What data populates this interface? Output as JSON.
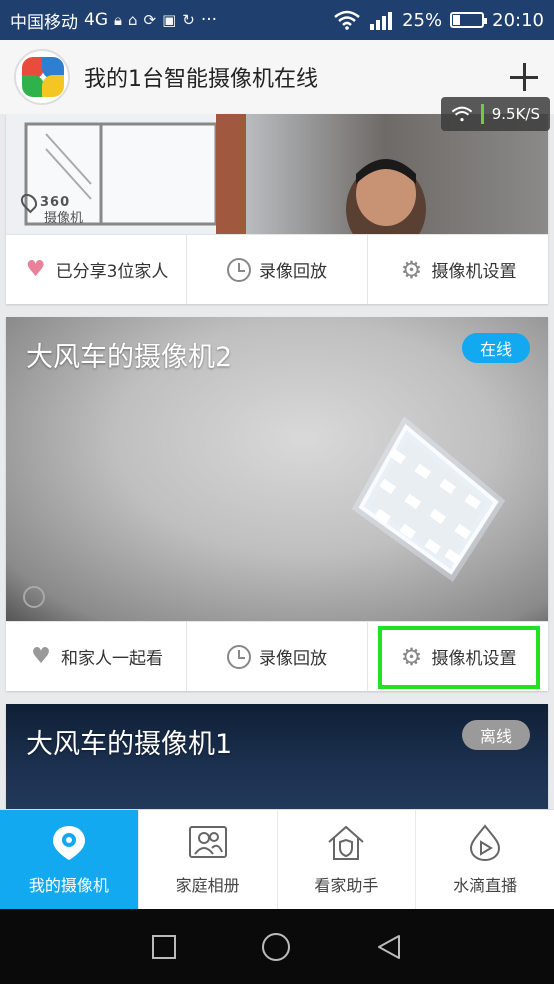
{
  "status_bar": {
    "carrier": "中国移动",
    "network": "4G",
    "battery": "25%",
    "time": "20:10",
    "ellipsis": "···",
    "battery_fraction": 0.25
  },
  "header": {
    "title": "我的1台智能摄像机在线"
  },
  "speed": "9.5K/S",
  "cameras": [
    {
      "title": "",
      "watermark_logo": "360",
      "watermark_text": "摄像机",
      "actions": [
        "已分享3位家人",
        "录像回放",
        "摄像机设置"
      ]
    },
    {
      "title": "大风车的摄像机2",
      "status": "在线",
      "status_color": "#12a9f0",
      "actions": [
        "和家人一起看",
        "录像回放",
        "摄像机设置"
      ]
    },
    {
      "title": "大风车的摄像机1",
      "status": "离线",
      "status_color": "#9a9a9a"
    }
  ],
  "bottom_nav": [
    {
      "label": "我的摄像机",
      "icon": "camera-pin-icon",
      "active": true
    },
    {
      "label": "家庭相册",
      "icon": "people-album-icon",
      "active": false
    },
    {
      "label": "看家助手",
      "icon": "house-shield-icon",
      "active": false
    },
    {
      "label": "水滴直播",
      "icon": "play-drop-icon",
      "active": false
    }
  ],
  "system_nav": [
    "square-icon",
    "circle-icon",
    "back-triangle-icon"
  ],
  "colors": {
    "accent": "#12a9f0",
    "highlight": "#22e022",
    "status_bar": "#1f3f6e"
  }
}
